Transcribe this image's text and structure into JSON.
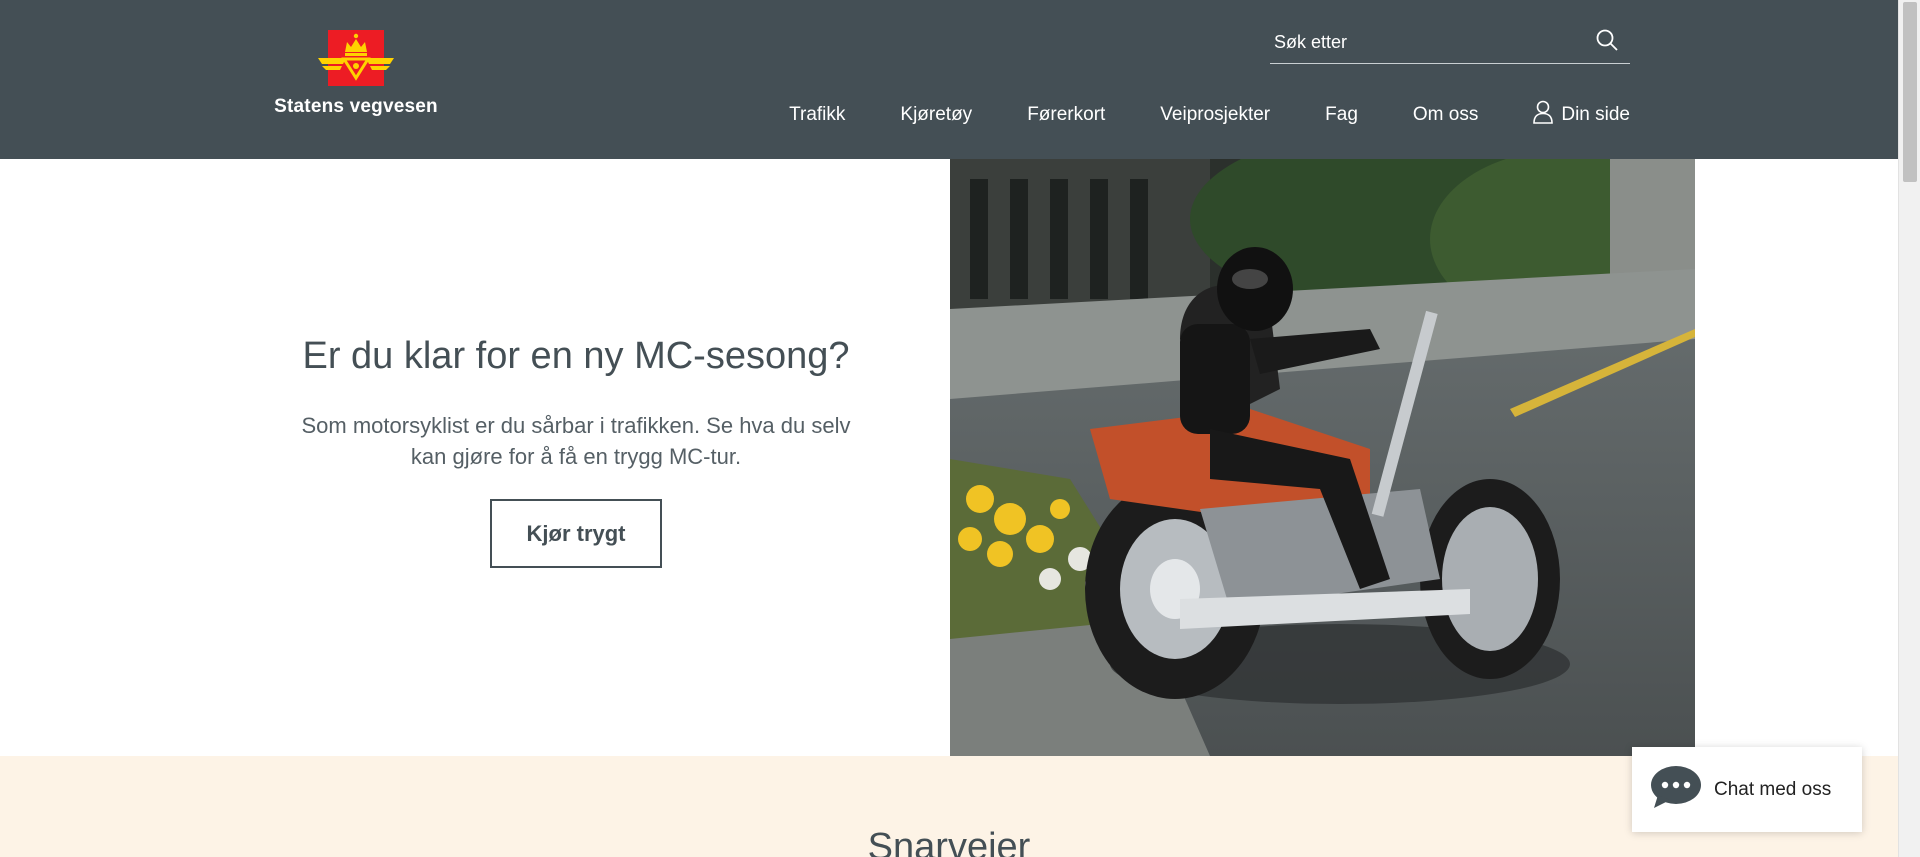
{
  "header": {
    "logo_text": "Statens vegvesen",
    "search_placeholder": "Søk etter",
    "nav": [
      {
        "label": "Trafikk"
      },
      {
        "label": "Kjøretøy"
      },
      {
        "label": "Førerkort"
      },
      {
        "label": "Veiprosjekter"
      },
      {
        "label": "Fag"
      },
      {
        "label": "Om oss"
      },
      {
        "label": "Din side"
      }
    ]
  },
  "hero": {
    "title": "Er du klar for en ny MC-sesong?",
    "description": "Som motorsyklist er du sårbar i trafikken. Se hva du selv kan gjøre for å få en trygg MC-tur.",
    "button_label": "Kjør trygt"
  },
  "shortcuts": {
    "title": "Snarveier"
  },
  "chat": {
    "label": "Chat med oss"
  },
  "colors": {
    "header_bg": "#444f55",
    "shortcuts_bg": "#fdf3e6",
    "text": "#444f55",
    "logo_red": "#ed1c24",
    "logo_yellow": "#ffd200"
  }
}
